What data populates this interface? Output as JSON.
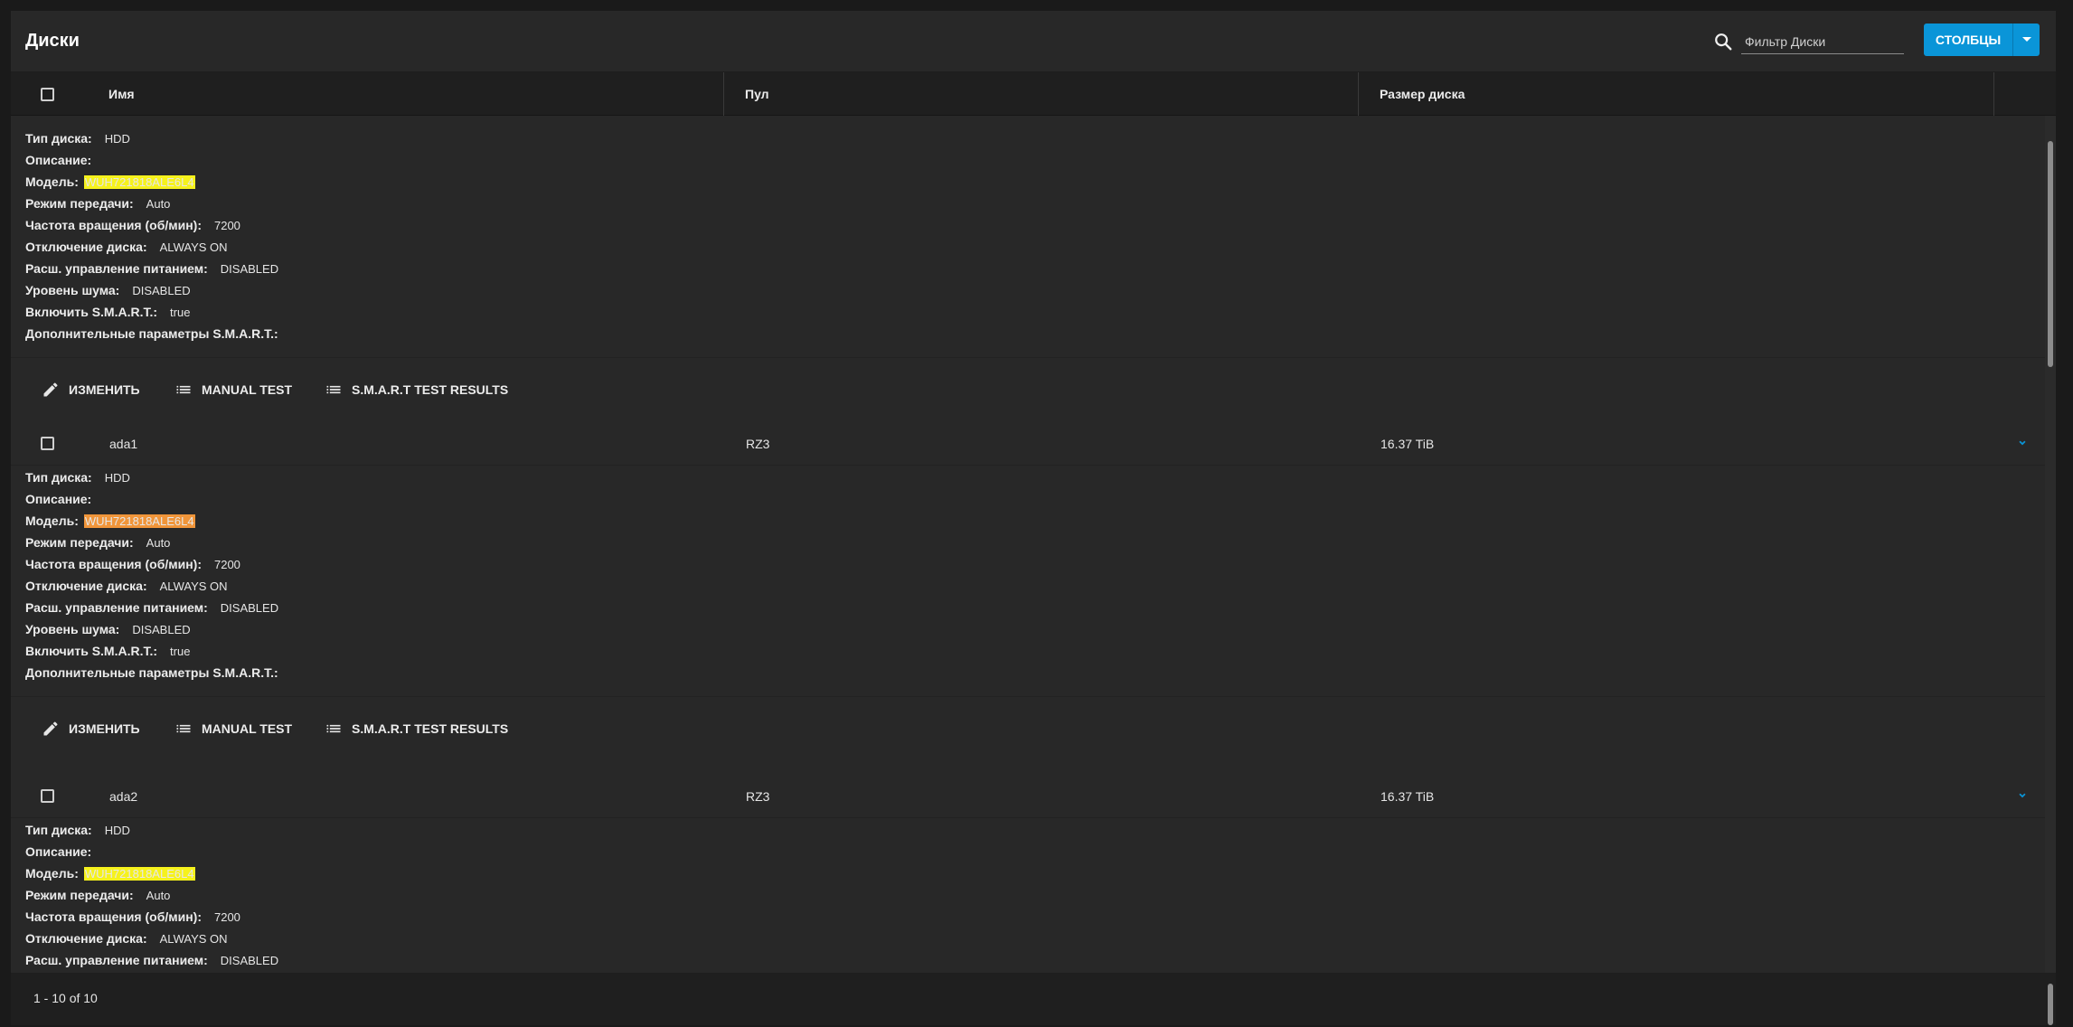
{
  "toolbar": {
    "title": "Диски",
    "search_placeholder": "Фильтр Диски",
    "columns_label": "СТОЛБЦЫ"
  },
  "table": {
    "columns": [
      "Имя",
      "Пул",
      "Размер диска"
    ]
  },
  "detail_labels": {
    "disk_type": "Тип диска:",
    "description": "Описание:",
    "model": "Модель:",
    "transfer_mode": "Режим передачи:",
    "rotation_rate": "Частота вращения (об/мин):",
    "standby": "Отключение диска:",
    "adv_power": "Расш. управление питанием:",
    "acoustic": "Уровень шума:",
    "smart_enabled": "Включить S.M.A.R.T.:",
    "smart_options": "Дополнительные параметры S.M.A.R.T.:"
  },
  "actions": {
    "edit": "ИЗМЕНИТЬ",
    "manual_test": "MANUAL TEST",
    "smart_results": "S.M.A.R.T TEST RESULTS"
  },
  "details": [
    {
      "disk_type": "HDD",
      "description": "",
      "model": "WUH721818ALE6L4",
      "transfer_mode": "Auto",
      "rotation_rate": "7200",
      "standby": "ALWAYS ON",
      "adv_power": "DISABLED",
      "acoustic": "DISABLED",
      "smart_enabled": "true",
      "smart_options": ""
    },
    {
      "disk_type": "HDD",
      "description": "",
      "model": "WUH721818ALE6L4",
      "transfer_mode": "Auto",
      "rotation_rate": "7200",
      "standby": "ALWAYS ON",
      "adv_power": "DISABLED",
      "acoustic": "DISABLED",
      "smart_enabled": "true",
      "smart_options": ""
    },
    {
      "disk_type": "HDD",
      "description": "",
      "model": "WUH721818ALE6L4",
      "transfer_mode": "Auto",
      "rotation_rate": "7200",
      "standby": "ALWAYS ON",
      "adv_power": "DISABLED",
      "acoustic": "",
      "smart_enabled": "",
      "smart_options": ""
    }
  ],
  "rows": [
    {
      "name": "ada1",
      "pool": "RZ3",
      "size": "16.37 TiB"
    },
    {
      "name": "ada2",
      "pool": "RZ3",
      "size": "16.37 TiB"
    }
  ],
  "footer": {
    "pager": "1 - 10 of 10"
  },
  "colors": {
    "accent": "#0a95d8",
    "highlight_match": "#f6f21c",
    "highlight_current": "#f0953a"
  }
}
